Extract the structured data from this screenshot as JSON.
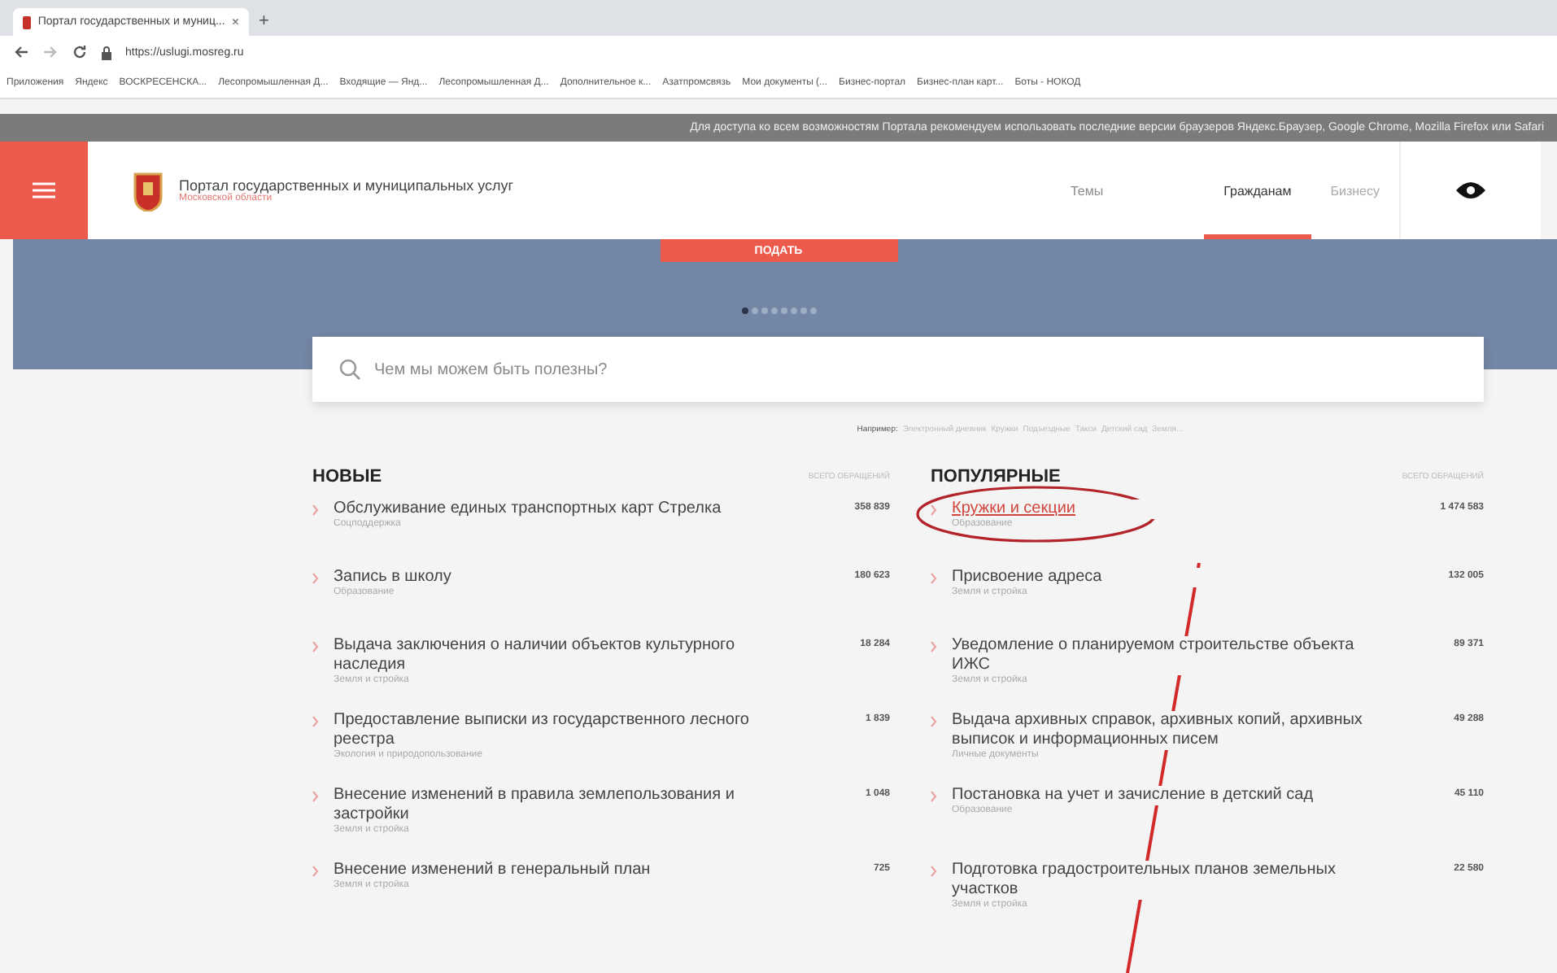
{
  "browser": {
    "tab_title": "Портал государственных и муниц...",
    "tab_close": "×",
    "new_tab": "+",
    "url": "https://uslugi.mosreg.ru",
    "bookmarks": [
      "Приложения",
      "Яндекс",
      "ВОСКРЕСЕНСКА...",
      "Лесопромышленная Д...",
      "Входящие — Янд...",
      "Лесопромышленная Д...",
      "Дополнительное к...",
      "Азатпромсвязь",
      "Мои документы (...",
      "Бизнес-портал",
      "Бизнес-план карт...",
      "Боты - НОКОД"
    ]
  },
  "notice": "Для доступа ко всем возможностям Портала рекомендуем использовать последние версии браузеров Яндекс.Браузер, Google Chrome, Mozilla Firefox или Safari",
  "header": {
    "title": "Портал государственных и муниципальных услуг",
    "subtitle": "Московской области",
    "nav": [
      {
        "label": "Темы",
        "selected": false
      },
      {
        "label": "Гражданам",
        "selected": true
      },
      {
        "label": "Бизнесу",
        "selected": false
      }
    ]
  },
  "hero": {
    "button": "ПОДАТЬ",
    "dots": [
      {
        "selected": true
      },
      {
        "selected": false
      },
      {
        "selected": false
      },
      {
        "selected": false
      },
      {
        "selected": false
      },
      {
        "selected": false
      },
      {
        "selected": false
      },
      {
        "selected": false
      }
    ]
  },
  "search": {
    "placeholder": "Чем мы можем быть полезны?",
    "examples_label": "Например:",
    "examples": [
      "Электронный дневник",
      "Кружки",
      "Подъездные",
      "Такси",
      "Детский сад",
      "Земля..."
    ]
  },
  "sections": [
    {
      "title": "НОВЫЕ",
      "count_label": "ВСЕГО ОБРАЩЕНИЙ",
      "items": [
        {
          "name": "Обслуживание единых транспортных карт Стрелка",
          "category": "Соцподдержка",
          "count": "358 839",
          "active": false
        },
        {
          "name": "Запись в школу",
          "category": "Образование",
          "count": "180 623",
          "active": false
        },
        {
          "name": "Выдача заключения о наличии объектов культурного наследия",
          "category": "Земля и стройка",
          "count": "18 284",
          "active": false
        },
        {
          "name": "Предоставление выписки из государственного лесного реестра",
          "category": "Экология и природопользование",
          "count": "1 839",
          "active": false
        },
        {
          "name": "Внесение изменений в правила землепользования и застройки",
          "category": "Земля и стройка",
          "count": "1 048",
          "active": false
        },
        {
          "name": "Внесение изменений в генеральный план",
          "category": "Земля и стройка",
          "count": "725",
          "active": false
        }
      ]
    },
    {
      "title": "ПОПУЛЯРНЫЕ",
      "count_label": "ВСЕГО ОБРАЩЕНИЙ",
      "items": [
        {
          "name": "Кружки и секции",
          "category": "Образование",
          "count": "1 474 583",
          "active": true
        },
        {
          "name": "Присвоение адреса",
          "category": "Земля и стройка",
          "count": "132 005",
          "active": false
        },
        {
          "name": "Уведомление о планируемом строительстве объекта ИЖС",
          "category": "Земля и стройка",
          "count": "89 371",
          "active": false
        },
        {
          "name": "Выдача архивных справок, архивных копий, архивных выписок и информационных писем",
          "category": "Личные документы",
          "count": "49 288",
          "active": false
        },
        {
          "name": "Постановка на учет и зачисление в детский сад",
          "category": "Образование",
          "count": "45 110",
          "active": false
        },
        {
          "name": "Подготовка градостроительных планов земельных участков",
          "category": "Земля и стройка",
          "count": "22 580",
          "active": false
        }
      ]
    }
  ]
}
